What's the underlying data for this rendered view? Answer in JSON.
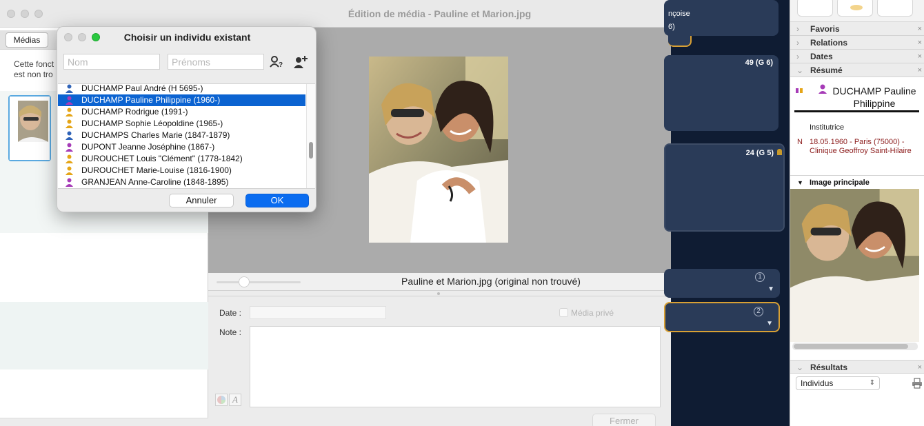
{
  "left_window": {
    "tab_label": "Médias",
    "info_text_line1": "Cette fonct",
    "info_text_line2": "est non tro"
  },
  "media_window": {
    "title": "Édition de média - Pauline et Marion.jpg",
    "caption": "Pauline et Marion.jpg (original non trouvé)",
    "date_label": "Date :",
    "date_value": "",
    "private_label": "Média privé",
    "note_label": "Note :",
    "note_value": "",
    "close_label": "Fermer"
  },
  "chooser_dialog": {
    "title": "Choisir un individu existant",
    "nom_placeholder": "Nom",
    "prenoms_placeholder": "Prénoms",
    "items": [
      {
        "label": "DUCHAMP Paul André (H 5695-)",
        "sex": "male",
        "selected": false
      },
      {
        "label": "DUCHAMP Pauline Philippine (1960-)",
        "sex": "female",
        "selected": true
      },
      {
        "label": "DUCHAMP Rodrigue (1991-)",
        "sex": "unknown",
        "selected": false
      },
      {
        "label": "DUCHAMP Sophie Léopoldine (1965-)",
        "sex": "unknown",
        "selected": false
      },
      {
        "label": "DUCHAMPS Charles Marie (1847-1879)",
        "sex": "male",
        "selected": false
      },
      {
        "label": "DUPONT Jeanne Joséphine (1867-)",
        "sex": "female",
        "selected": false
      },
      {
        "label": "DUROUCHET Louis \"Clément\" (1778-1842)",
        "sex": "unknown",
        "selected": false
      },
      {
        "label": "DUROUCHET Marie-Louise (1816-1900)",
        "sex": "unknown",
        "selected": false
      },
      {
        "label": "GRANJEAN Anne-Caroline (1848-1895)",
        "sex": "female",
        "selected": false
      }
    ],
    "cancel_label": "Annuler",
    "ok_label": "OK"
  },
  "tree": {
    "card1_text": "nçoise",
    "card1_sub": "6)",
    "card2_text": "49 (G 6)",
    "card3_text": "24 (G 5)",
    "card4_badge": "1",
    "card5_badge": "2"
  },
  "sidebar": {
    "sections": [
      "Favoris",
      "Relations",
      "Dates",
      "Résumé"
    ],
    "person_name": "DUCHAMP Pauline Philippine",
    "occupation": "Institutrice",
    "birth_prefix": "N",
    "birth_text": "18.05.1960 - Paris (75000) - Clinique Geoffroy Saint-Hilaire",
    "image_heading": "Image principale",
    "results_heading": "Résultats",
    "results_select": "Individus"
  },
  "colors": {
    "selection_blue": "#0b63d1",
    "male_icon": "#2f63b8",
    "female_icon": "#a63bb7",
    "unknown_icon": "#e5a517",
    "dark_tree_bg": "#0f1c33",
    "card_bg": "#2a3b58",
    "card_highlight": "#d8a034"
  }
}
